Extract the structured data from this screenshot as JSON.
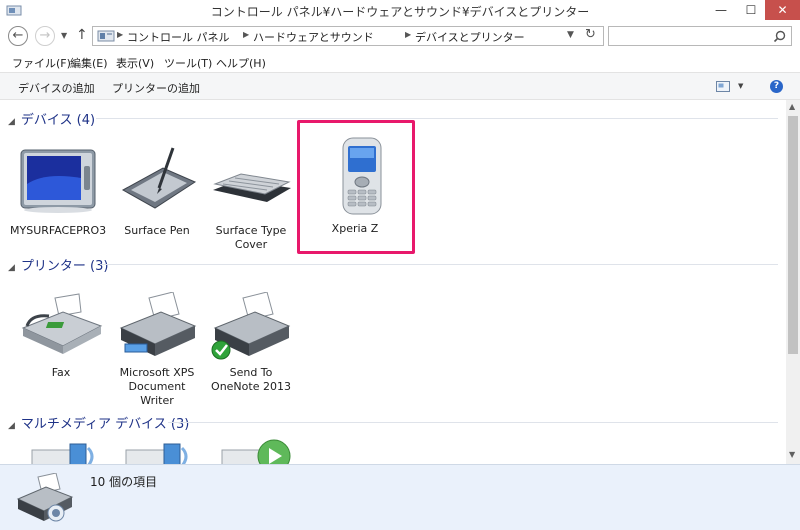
{
  "window": {
    "title": "コントロール パネル¥ハードウェアとサウンド¥デバイスとプリンター",
    "minimize": "—",
    "maximize": "☐",
    "close": "✕"
  },
  "address": {
    "breadcrumb": [
      "コントロール パネル",
      "ハードウェアとサウンド",
      "デバイスとプリンター"
    ],
    "back": "←",
    "forward": "→",
    "up": "↑",
    "refresh": "↻",
    "search_placeholder": ""
  },
  "menu": [
    "ファイル(F)",
    "編集(E)",
    "表示(V)",
    "ツール(T)",
    "ヘルプ(H)"
  ],
  "commands": {
    "add_device": "デバイスの追加",
    "add_printer": "プリンターの追加",
    "help": "?"
  },
  "groups": {
    "devices": {
      "header": "デバイス (4)",
      "items": [
        {
          "label": "MYSURFACEPRO3",
          "icon": "tablet-icon"
        },
        {
          "label": "Surface Pen",
          "icon": "pen-tablet-icon"
        },
        {
          "label": "Surface Type Cover",
          "icon": "keyboard-icon"
        },
        {
          "label": "Xperia Z",
          "icon": "phone-icon"
        }
      ]
    },
    "printers": {
      "header": "プリンター (3)",
      "items": [
        {
          "label": "Fax",
          "icon": "fax-icon"
        },
        {
          "label": "Microsoft XPS Document Writer",
          "icon": "printer-icon"
        },
        {
          "label": "Send To OneNote 2013",
          "icon": "printer-default-icon"
        }
      ]
    },
    "multimedia": {
      "header": "マルチメディア デバイス (3)"
    }
  },
  "status": {
    "count": "10 個の項目"
  },
  "colors": {
    "highlight": "#e8186b",
    "link_blue": "#1e3287",
    "close_red": "#c7504c"
  }
}
